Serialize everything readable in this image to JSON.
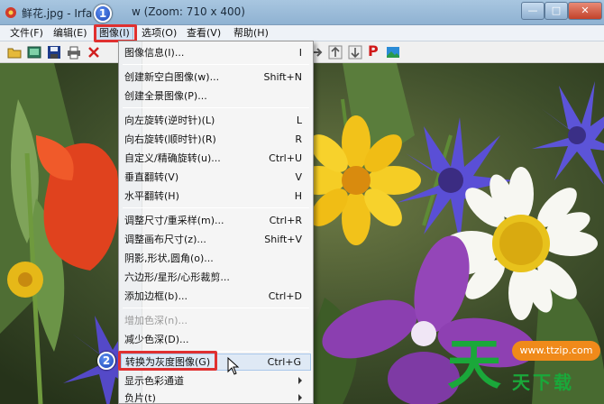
{
  "window": {
    "title": "鲜花.jpg - IrfanView (Zoom: 710 x 400)",
    "title_visible": "鲜花.jpg - Irfa",
    "title_tail": "w (Zoom: 710 x 400)",
    "min_glyph": "—",
    "max_glyph": "□",
    "close_glyph": "✕"
  },
  "menubar": {
    "items": [
      {
        "label": "文件(F)"
      },
      {
        "label": "编辑(E)"
      },
      {
        "label": "图像(I)"
      },
      {
        "label": "选项(O)"
      },
      {
        "label": "查看(V)"
      },
      {
        "label": "帮助(H)"
      }
    ]
  },
  "toolbar": {
    "icons": [
      "open-folder-icon",
      "slideshow-icon",
      "save-icon",
      "print-icon",
      "delete-icon",
      "arrow-right-icon",
      "page-up-icon",
      "page-down-icon",
      "paint-icon",
      "image-icon"
    ],
    "paint_glyph": "P"
  },
  "image_menu": {
    "items": [
      {
        "label": "图像信息(I)...",
        "shortcut": "I"
      },
      {
        "label": "创建新空白图像(w)...",
        "shortcut": "Shift+N"
      },
      {
        "label": "创建全景图像(P)...",
        "shortcut": ""
      },
      {
        "label": "向左旋转(逆时针)(L)",
        "shortcut": "L"
      },
      {
        "label": "向右旋转(顺时针)(R)",
        "shortcut": "R"
      },
      {
        "label": "自定义/精确旋转(u)...",
        "shortcut": "Ctrl+U"
      },
      {
        "label": "垂直翻转(V)",
        "shortcut": "V"
      },
      {
        "label": "水平翻转(H)",
        "shortcut": "H"
      },
      {
        "label": "调整尺寸/重采样(m)...",
        "shortcut": "Ctrl+R"
      },
      {
        "label": "调整画布尺寸(z)...",
        "shortcut": "Shift+V"
      },
      {
        "label": "阴影,形状,圆角(o)...",
        "shortcut": ""
      },
      {
        "label": "六边形/星形/心形裁剪...",
        "shortcut": ""
      },
      {
        "label": "添加边框(b)...",
        "shortcut": "Ctrl+D"
      },
      {
        "label": "增加色深(n)...",
        "shortcut": ""
      },
      {
        "label": "减少色深(D)...",
        "shortcut": ""
      },
      {
        "label": "转换为灰度图像(G)",
        "shortcut": "Ctrl+G"
      },
      {
        "label": "显示色彩通道",
        "shortcut": ""
      },
      {
        "label": "负片(t)",
        "shortcut": ""
      }
    ]
  },
  "annotations": {
    "step1": "1",
    "step2": "2",
    "highlight_color": "#e03030"
  },
  "watermark": {
    "big_char": "天",
    "pill_text": "www.ttzip.com",
    "small_text": "天下载"
  },
  "colors": {
    "menu_hover": "#dfe9f5",
    "badge_blue": "#1c46b8",
    "watermark_green": "#1aa83a",
    "watermark_orange": "#f08a1a"
  }
}
